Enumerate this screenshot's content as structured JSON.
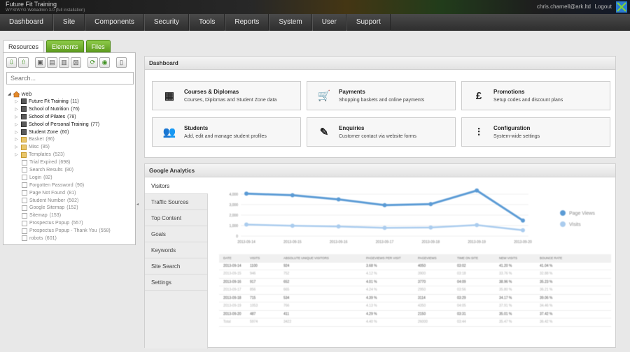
{
  "header": {
    "brand_title": "Future Fit Training",
    "brand_sub": "WYSIWYG Webadmin 3.0 (full installation)",
    "user_email": "chris.charnell@ark.ltd",
    "logout_label": "Logout"
  },
  "nav": [
    "Dashboard",
    "Site",
    "Components",
    "Security",
    "Tools",
    "Reports",
    "System",
    "User",
    "Support"
  ],
  "sidebar": {
    "tabs": [
      "Resources",
      "Elements",
      "Files"
    ],
    "search_placeholder": "Search...",
    "root": "web",
    "tree": [
      {
        "label": "Future Fit Training",
        "count": "(11)",
        "type": "dark",
        "bold": true
      },
      {
        "label": "School of Nutrition",
        "count": "(76)",
        "type": "dark",
        "bold": true
      },
      {
        "label": "School of Pilates",
        "count": "(78)",
        "type": "dark",
        "bold": true
      },
      {
        "label": "School of Personal Training",
        "count": "(77)",
        "type": "dark",
        "bold": true
      },
      {
        "label": "Student Zone",
        "count": "(60)",
        "type": "dark",
        "bold": true
      },
      {
        "label": "Basket",
        "count": "(86)",
        "type": "folder",
        "bold": false
      },
      {
        "label": "Misc",
        "count": "(85)",
        "type": "folder",
        "bold": false
      },
      {
        "label": "Templates",
        "count": "(523)",
        "type": "folder",
        "bold": false
      },
      {
        "label": "Trial Expired",
        "count": "(698)",
        "type": "page",
        "bold": false
      },
      {
        "label": "Search Results",
        "count": "(80)",
        "type": "page",
        "bold": false
      },
      {
        "label": "Login",
        "count": "(82)",
        "type": "page",
        "bold": false
      },
      {
        "label": "Forgotten Password",
        "count": "(90)",
        "type": "page",
        "bold": false
      },
      {
        "label": "Page Not Found",
        "count": "(81)",
        "type": "page",
        "bold": false
      },
      {
        "label": "Student Number",
        "count": "(502)",
        "type": "page",
        "bold": false
      },
      {
        "label": "Google Sitemap",
        "count": "(152)",
        "type": "page",
        "bold": false
      },
      {
        "label": "Sitemap",
        "count": "(153)",
        "type": "page",
        "bold": false
      },
      {
        "label": "Prospectus Popup",
        "count": "(557)",
        "type": "page",
        "bold": false
      },
      {
        "label": "Prospectus Popup - Thank You",
        "count": "(558)",
        "type": "page",
        "bold": false
      },
      {
        "label": "robots",
        "count": "(601)",
        "type": "page",
        "bold": false
      }
    ]
  },
  "dashboard": {
    "title": "Dashboard",
    "cards": [
      {
        "title": "Courses & Diplomas",
        "desc": "Courses, Diplomas and Student Zone data",
        "icon": "calendar-icon",
        "glyph": "▦"
      },
      {
        "title": "Payments",
        "desc": "Shopping baskets and online payments",
        "icon": "cart-icon",
        "glyph": "🛒"
      },
      {
        "title": "Promotions",
        "desc": "Setup codes and discount plans",
        "icon": "pound-icon",
        "glyph": "£"
      },
      {
        "title": "Students",
        "desc": "Add, edit and manage student profiles",
        "icon": "users-icon",
        "glyph": "👥"
      },
      {
        "title": "Enquiries",
        "desc": "Customer contact via website forms",
        "icon": "edit-icon",
        "glyph": "✎"
      },
      {
        "title": "Configuration",
        "desc": "System-wide settings",
        "icon": "sliders-icon",
        "glyph": "⫶"
      }
    ]
  },
  "analytics": {
    "title": "Google Analytics",
    "nav": [
      "Visitors",
      "Traffic Sources",
      "Top Content",
      "Goals",
      "Keywords",
      "Site Search",
      "Settings"
    ],
    "chart_data": {
      "type": "line",
      "x": [
        "2013-09-14",
        "2013-09-15",
        "2013-09-16",
        "2013-09-17",
        "2013-09-18",
        "2013-09-19",
        "2013-09-20"
      ],
      "y_ticks": [
        "4,000",
        "3,000",
        "2,000",
        "1,000",
        "0"
      ],
      "ylim": [
        0,
        4000
      ],
      "series": [
        {
          "name": "Page Views",
          "color": "#5b9bd5",
          "values": [
            4050,
            3900,
            3500,
            2950,
            3050,
            4350,
            1480
          ]
        },
        {
          "name": "Visits",
          "color": "#aaccee",
          "values": [
            1100,
            980,
            920,
            780,
            820,
            1050,
            560
          ]
        }
      ],
      "legend": "right"
    },
    "table": {
      "headers": [
        "DATE",
        "VISITS",
        "ABSOLUTE UNIQUE VISITORS",
        "PAGEVIEWS PER VISIT",
        "PAGEVIEWS",
        "TIME ON SITE",
        "NEW VISITS",
        "BOUNCE RATE"
      ],
      "rows": [
        [
          "2013-09-14",
          "1100",
          "924",
          "3.68 %",
          "4050",
          "03:02",
          "41.20 %",
          "41.04 %"
        ],
        [
          "2013-09-15",
          "946",
          "752",
          "4.12 %",
          "3900",
          "03:18",
          "33.76 %",
          "32.88 %"
        ],
        [
          "2013-09-16",
          "917",
          "652",
          "4.01 %",
          "3770",
          "04:09",
          "38.96 %",
          "35.23 %"
        ],
        [
          "2013-09-17",
          "856",
          "665",
          "4.24 %",
          "2950",
          "03:56",
          "35.80 %",
          "36.21 %"
        ],
        [
          "2013-09-18",
          "715",
          "534",
          "4.39 %",
          "3114",
          "03:29",
          "34.17 %",
          "39.06 %"
        ],
        [
          "2013-09-19",
          "1053",
          "766",
          "4.13 %",
          "4350",
          "04:05",
          "37.91 %",
          "34.46 %"
        ],
        [
          "2013-09-20",
          "487",
          "411",
          "4.29 %",
          "2150",
          "03:31",
          "35.01 %",
          "37.42 %"
        ],
        [
          "Total",
          "5974",
          "3422",
          "4.40 %",
          "26000",
          "03:44",
          "35.47 %",
          "36.42 %"
        ]
      ]
    }
  }
}
